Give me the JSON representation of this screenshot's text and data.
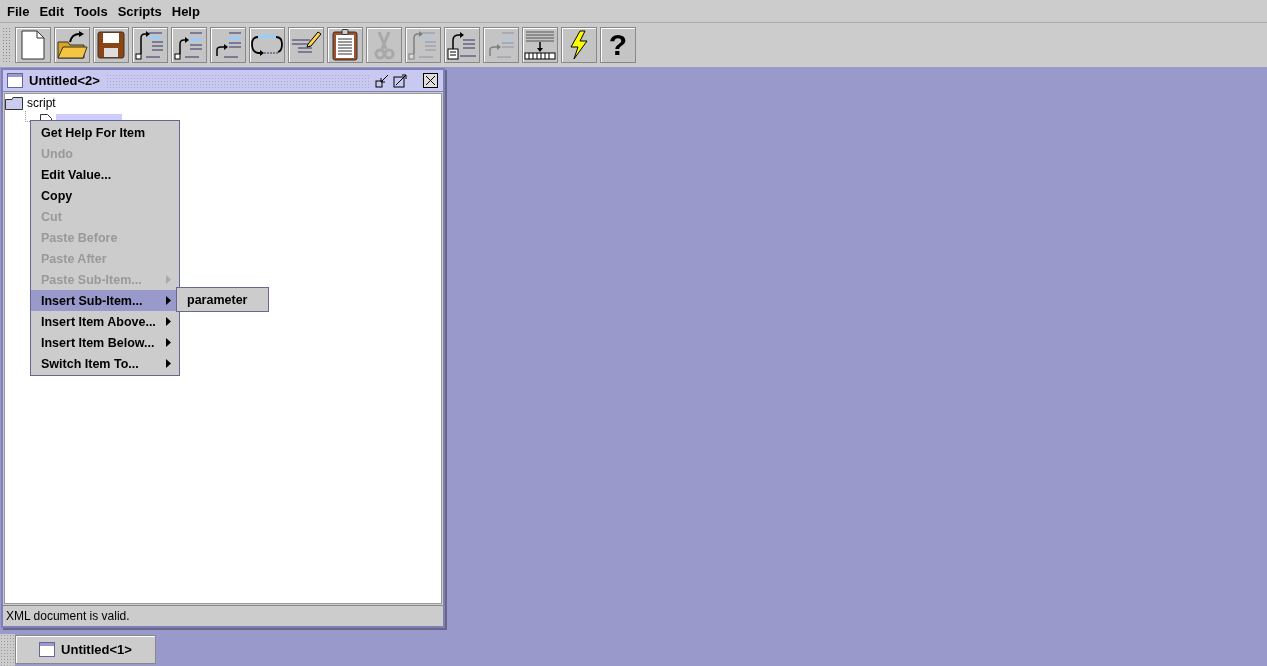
{
  "menubar": [
    "File",
    "Edit",
    "Tools",
    "Scripts",
    "Help"
  ],
  "toolbar": [
    {
      "kind": "new",
      "disabled": false
    },
    {
      "kind": "open",
      "disabled": false
    },
    {
      "kind": "save",
      "disabled": false
    },
    {
      "kind": "insert-sub",
      "disabled": false
    },
    {
      "kind": "insert-above",
      "disabled": false
    },
    {
      "kind": "insert-below",
      "disabled": false
    },
    {
      "kind": "loop",
      "disabled": false
    },
    {
      "kind": "edit",
      "disabled": false
    },
    {
      "kind": "paste",
      "disabled": false
    },
    {
      "kind": "cut",
      "disabled": true
    },
    {
      "kind": "insert-sub",
      "disabled": true
    },
    {
      "kind": "import",
      "disabled": false
    },
    {
      "kind": "insert-below",
      "disabled": true
    },
    {
      "kind": "compile",
      "disabled": false
    },
    {
      "kind": "run",
      "disabled": false
    },
    {
      "kind": "help",
      "disabled": false,
      "label": "?"
    }
  ],
  "window": {
    "title": "Untitled<2>",
    "status": "XML document is valid.",
    "tree": [
      {
        "label": "script",
        "kind": "folder",
        "selected": false,
        "children": [
          {
            "kind": "document",
            "selected": true
          }
        ]
      }
    ]
  },
  "context_menu": [
    {
      "label": "Get Help For Item",
      "disabled": false,
      "submenu": false,
      "selected": false
    },
    {
      "label": "Undo",
      "disabled": true,
      "submenu": false,
      "selected": false
    },
    {
      "label": "Edit Value...",
      "disabled": false,
      "submenu": false,
      "selected": false
    },
    {
      "label": "Copy",
      "disabled": false,
      "submenu": false,
      "selected": false
    },
    {
      "label": "Cut",
      "disabled": true,
      "submenu": false,
      "selected": false
    },
    {
      "label": "Paste Before",
      "disabled": true,
      "submenu": false,
      "selected": false
    },
    {
      "label": "Paste After",
      "disabled": true,
      "submenu": false,
      "selected": false
    },
    {
      "label": "Paste Sub-Item...",
      "disabled": true,
      "submenu": true,
      "selected": false
    },
    {
      "label": "Insert Sub-Item...",
      "disabled": false,
      "submenu": true,
      "selected": true,
      "items": [
        {
          "label": "parameter"
        }
      ]
    },
    {
      "label": "Insert Item Above...",
      "disabled": false,
      "submenu": true,
      "selected": false
    },
    {
      "label": "Insert Item Below...",
      "disabled": false,
      "submenu": true,
      "selected": false
    },
    {
      "label": "Switch Item To...",
      "disabled": false,
      "submenu": true,
      "selected": false
    }
  ],
  "minimized_windows": [
    {
      "title": "Untitled<1>"
    }
  ]
}
